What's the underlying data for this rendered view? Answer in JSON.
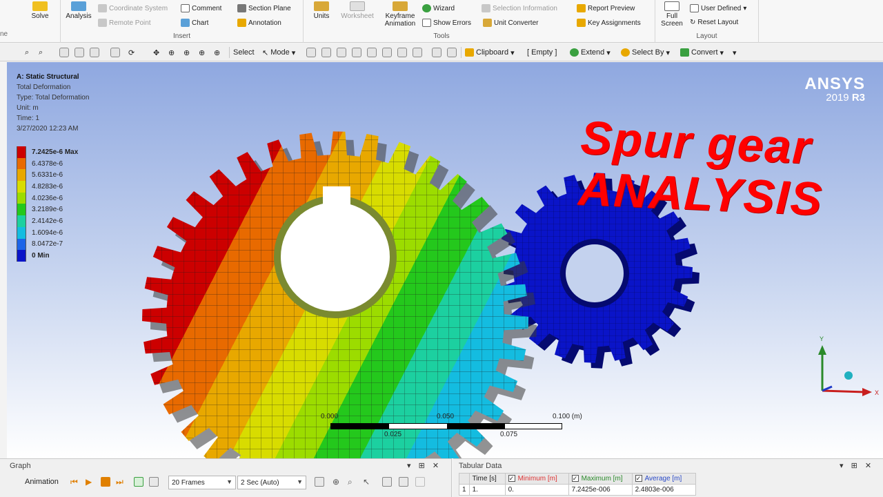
{
  "ribbon": {
    "solve_label": "Solve",
    "analysis_label": "Analysis",
    "coordinate_system_label": "Coordinate System",
    "remote_point_label": "Remote Point",
    "comment_label": "Comment",
    "chart_label": "Chart",
    "section_plane_label": "Section Plane",
    "annotation_label": "Annotation",
    "insert_group_label": "Insert",
    "units_label": "Units",
    "worksheet_label": "Worksheet",
    "keyframe_label": "Keyframe Animation",
    "wizard_label": "Wizard",
    "show_errors_label": "Show Errors",
    "unit_converter_label": "Unit Converter",
    "selection_information_label": "Selection Information",
    "report_preview_label": "Report Preview",
    "key_assignments_label": "Key Assignments",
    "tools_group_label": "Tools",
    "full_screen_label": "Full Screen",
    "user_defined_label": "User Defined",
    "reset_layout_label": "Reset Layout",
    "layout_group_label": "Layout",
    "left_cut_label": "ne"
  },
  "toolbar": {
    "select_label": "Select",
    "mode_label": "Mode",
    "clipboard_label": "Clipboard",
    "empty_label": "[ Empty ]",
    "extend_label": "Extend",
    "select_by_label": "Select By",
    "convert_label": "Convert"
  },
  "viewport": {
    "info": {
      "line1": "A: Static Structural",
      "line2": "Total Deformation",
      "line3": "Type: Total Deformation",
      "line4": "Unit: m",
      "line5": "Time: 1",
      "line6": "3/27/2020 12:23 AM"
    },
    "legend": [
      {
        "label": "7.2425e-6 Max",
        "color": "#cc0000"
      },
      {
        "label": "6.4378e-6",
        "color": "#e86a00"
      },
      {
        "label": "5.6331e-6",
        "color": "#e8a800"
      },
      {
        "label": "4.8283e-6",
        "color": "#d8dc00"
      },
      {
        "label": "4.0236e-6",
        "color": "#9cdc00"
      },
      {
        "label": "3.2189e-6",
        "color": "#24c81c"
      },
      {
        "label": "2.4142e-6",
        "color": "#1cd0a0"
      },
      {
        "label": "1.6094e-6",
        "color": "#14bce0"
      },
      {
        "label": "8.0472e-7",
        "color": "#1c64e8"
      },
      {
        "label": "0 Min",
        "color": "#0a14c8"
      }
    ],
    "logo_name": "ANSYS",
    "logo_year": "2019",
    "logo_release": "R3",
    "title_line1": "Spur gear",
    "title_line2": "ANALYSIS",
    "scale_labels": {
      "t0": "0.000",
      "t1": "0.050",
      "t2": "0.100 (m)",
      "b1": "0.025",
      "b2": "0.075"
    },
    "gear_color_big": [
      "#cc0000",
      "#e86a00",
      "#e8a800",
      "#d8dc00",
      "#9cdc00",
      "#24c81c",
      "#1cd0a0",
      "#14bce0"
    ],
    "gear_color_small": "#0a14c8"
  },
  "graph_panel": {
    "title": "Graph",
    "animation_label": "Animation",
    "frames_value": "20 Frames",
    "duration_value": "2 Sec (Auto)"
  },
  "tabular_panel": {
    "title": "Tabular Data",
    "headers": [
      "Time [s]",
      "Minimum [m]",
      "Maximum [m]",
      "Average [m]"
    ],
    "row": [
      "1",
      "1.",
      "0.",
      "7.2425e-006",
      "2.4803e-006"
    ]
  }
}
